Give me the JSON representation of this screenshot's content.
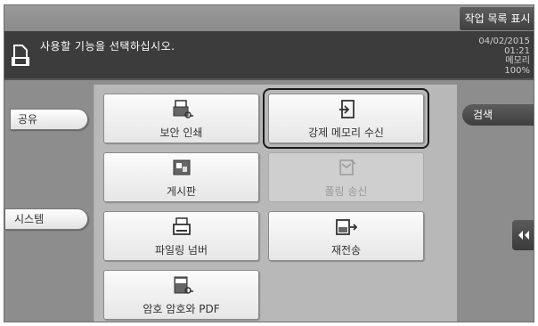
{
  "topbar": {
    "job_list_label": "작업 목록 표시"
  },
  "message": {
    "text": "사용할 기능을 선택하십시오."
  },
  "status": {
    "date": "04/02/2015",
    "time": "01:21",
    "memory_label": "메모리",
    "memory_value": "100%"
  },
  "left_tabs": {
    "share": "공유",
    "system": "시스템"
  },
  "functions": [
    {
      "label": "보안 인쇄",
      "icon": "secure-print-icon",
      "enabled": true
    },
    {
      "label": "강제 메모리 수신",
      "icon": "forced-memory-rx-icon",
      "enabled": true
    },
    {
      "label": "게시판",
      "icon": "bulletin-board-icon",
      "enabled": true
    },
    {
      "label": "폴링 송신",
      "icon": "polling-tx-icon",
      "enabled": false
    },
    {
      "label": "파일링 넘버",
      "icon": "filing-number-icon",
      "enabled": true
    },
    {
      "label": "재전송",
      "icon": "retransmit-icon",
      "enabled": true
    },
    {
      "label": "암호 암호와 PDF",
      "icon": "encrypted-pdf-icon",
      "enabled": true
    }
  ],
  "right_tabs": {
    "search": "검색"
  },
  "colors": {
    "panel_bg": "#8d8d8d",
    "main_bg": "#b8b8b8",
    "message_bg": "#3c3c3c",
    "dark_tab": "#4a4a4a"
  }
}
